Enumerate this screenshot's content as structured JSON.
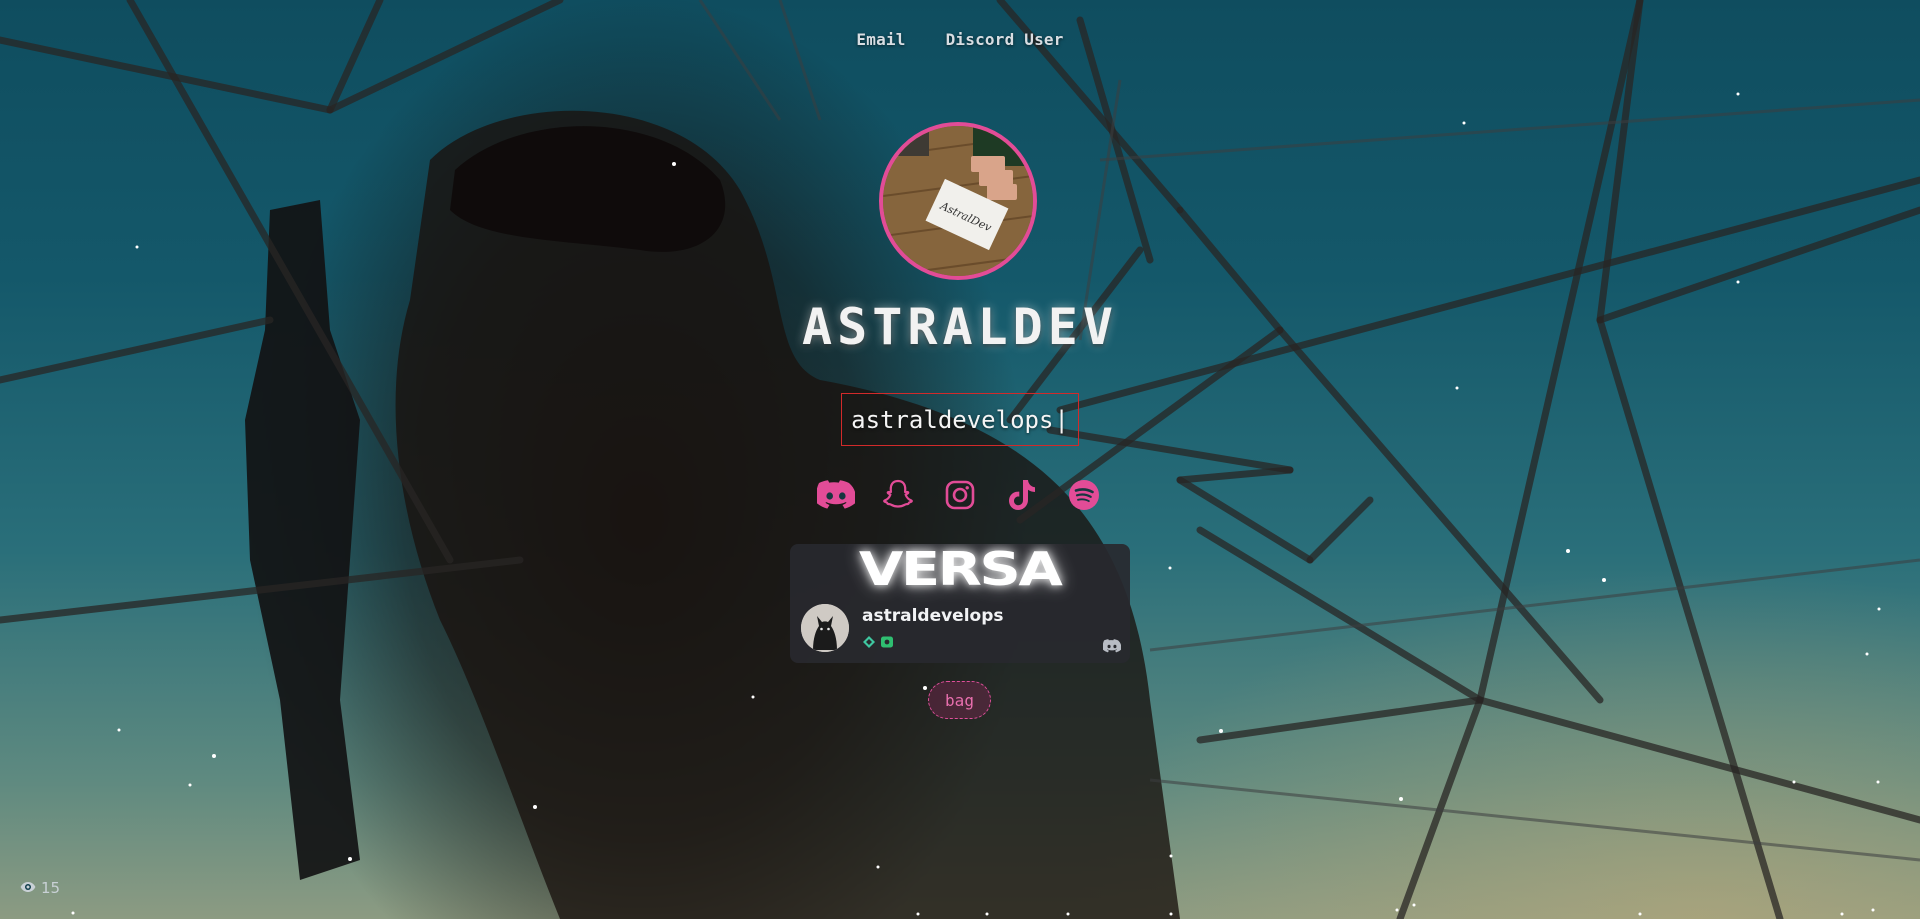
{
  "header": {
    "links": [
      {
        "label": "Email"
      },
      {
        "label": "Discord User"
      }
    ]
  },
  "profile": {
    "display_name": "ASTRALDEV",
    "typing_text": "astraldevelops",
    "typing_cursor": "|",
    "avatar_caption": "AstralDev",
    "accent_color": "#e24c97"
  },
  "socials": [
    {
      "icon": "discord-icon"
    },
    {
      "icon": "snapchat-icon"
    },
    {
      "icon": "instagram-icon"
    },
    {
      "icon": "tiktok-icon"
    },
    {
      "icon": "spotify-icon"
    }
  ],
  "discord_card": {
    "banner_text": "VERSA",
    "username": "astraldevelops",
    "badges": [
      "hypesquad-icon",
      "nitro-icon"
    ]
  },
  "tags": [
    {
      "label": "bag"
    }
  ],
  "views": {
    "count": "15",
    "icon": "eye-icon"
  }
}
